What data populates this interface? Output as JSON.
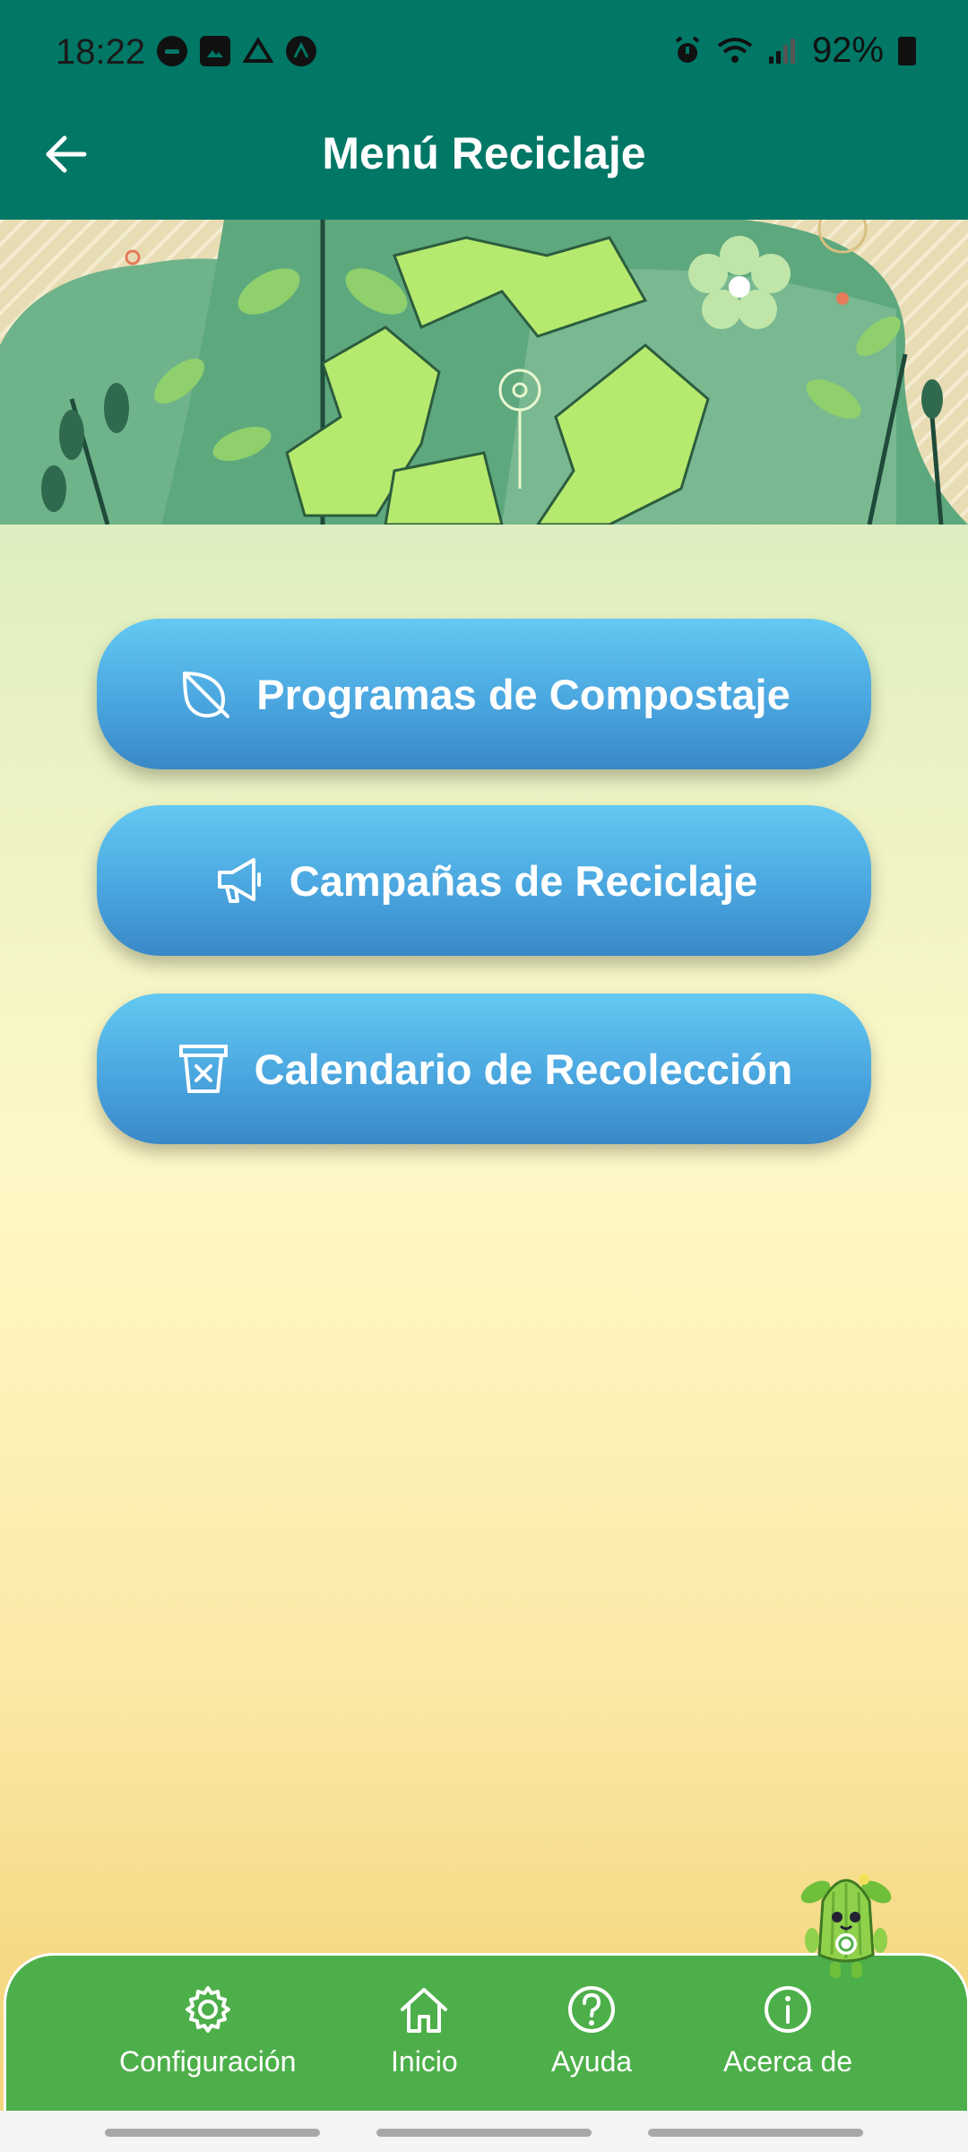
{
  "status": {
    "time": "18:22",
    "battery": "92%"
  },
  "appbar": {
    "title": "Menú Reciclaje"
  },
  "menu": [
    {
      "label": "Programas de Compostaje",
      "icon": "leaf-icon"
    },
    {
      "label": "Campañas de Reciclaje",
      "icon": "megaphone-icon"
    },
    {
      "label": "Calendario de Recolección",
      "icon": "bin-icon"
    }
  ],
  "nav": [
    {
      "label": "Configuración",
      "icon": "gear-icon"
    },
    {
      "label": "Inicio",
      "icon": "home-icon"
    },
    {
      "label": "Ayuda",
      "icon": "help-icon"
    },
    {
      "label": "Acerca de",
      "icon": "info-icon"
    }
  ],
  "colors": {
    "appbar": "#017766",
    "button": "#4aa6df",
    "nav": "#4daf4a"
  }
}
